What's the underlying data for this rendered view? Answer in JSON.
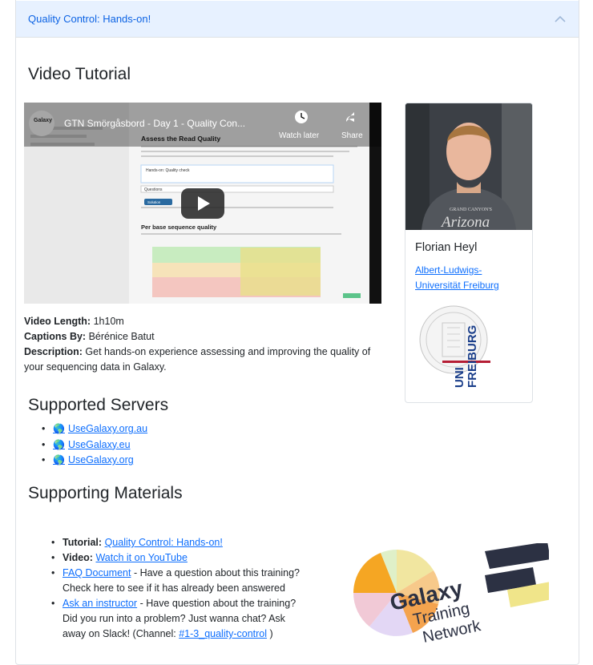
{
  "accordion": {
    "title": "Quality Control: Hands-on!"
  },
  "video_section": {
    "heading": "Video Tutorial",
    "player": {
      "title": "GTN Smörgåsbord - Day 1 - Quality Con...",
      "watch_later": "Watch later",
      "share": "Share",
      "channel_badge": "Galaxy",
      "slide_heading": "Assess the Read Quality",
      "slide_hands_on": "Hands-on: Quality check",
      "slide_question": "Questions",
      "slide_solution": "Solution",
      "slide_sub_heading": "Per base sequence quality"
    },
    "length_label": "Video Length:",
    "length_value": "1h10m",
    "captions_label": "Captions By:",
    "captions_value": "Bérénice Batut",
    "description_label": "Description:",
    "description_value": "Get hands-on experience assessing and improving the quality of your sequencing data in Galaxy."
  },
  "author": {
    "name": "Florian Heyl",
    "affiliation": "Albert-Ludwigs-Universität Freiburg",
    "shirt_text": "Arizona",
    "logo_text_1": "UNI",
    "logo_text_2": "FREIBURG"
  },
  "servers_section": {
    "heading": "Supported Servers",
    "globe_icon": "🌎",
    "items": [
      "UseGalaxy.org.au",
      "UseGalaxy.eu",
      "UseGalaxy.org"
    ]
  },
  "materials_section": {
    "heading": "Supporting Materials",
    "tutorial_label": "Tutorial:",
    "tutorial_link": "Quality Control: Hands-on!",
    "video_label": "Video:",
    "video_link": "Watch it on YouTube",
    "faq_link": "FAQ Document",
    "faq_text": "- Have a question about this training? Check here to see if it has already been answered",
    "ask_link": "Ask an instructor",
    "ask_text": "- Have question about the training? Did you run into a problem? Just wanna chat? Ask away on Slack! (Channel:",
    "channel_link": "#1-3_quality-control",
    "channel_close": ")"
  },
  "gtn_logo": {
    "line1": "Galaxy",
    "line2": "Training",
    "line3": "Network"
  },
  "colors": {
    "link": "#0d6efd",
    "accordion_bg": "#e7f1ff",
    "accordion_text": "#0c63e4"
  }
}
